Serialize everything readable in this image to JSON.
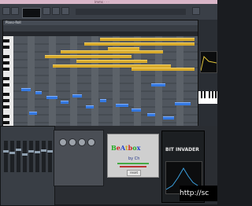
{
  "window": {
    "title": "lmms - untitled",
    "title_display": "lmms · ·  ·"
  },
  "piano_roll": {
    "title": "Piano-Roll"
  },
  "beatbox": {
    "title_parts": [
      "B",
      "e",
      "A",
      "t",
      "b",
      "o",
      "x"
    ],
    "by": "by Ch",
    "button": "reset"
  },
  "bitinvader": {
    "title": "BIT INVADER"
  },
  "url_text": "http://sc",
  "colors": {
    "note_gold": "#d7a92b",
    "note_blue": "#3478e0",
    "grid_bg": "#50565e"
  }
}
